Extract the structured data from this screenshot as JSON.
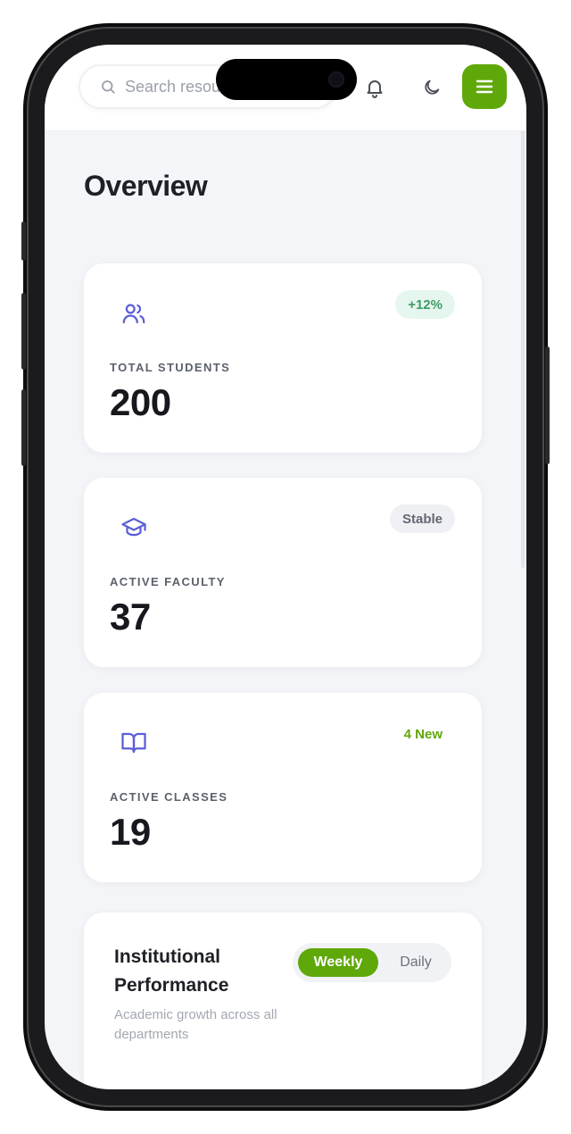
{
  "header": {
    "search_placeholder": "Search resources...",
    "icons": [
      "search-icon",
      "bell-icon",
      "moon-icon",
      "hamburger-menu-icon"
    ],
    "accent_color": "#5fa80a"
  },
  "page": {
    "title": "Overview"
  },
  "stats": [
    {
      "icon": "users-icon",
      "label": "TOTAL STUDENTS",
      "value": "200",
      "badge": "+12%",
      "badge_style": "green"
    },
    {
      "icon": "graduation-cap-icon",
      "label": "ACTIVE FACULTY",
      "value": "37",
      "badge": "Stable",
      "badge_style": "gray"
    },
    {
      "icon": "book-open-icon",
      "label": "ACTIVE CLASSES",
      "value": "19",
      "badge": "4 New",
      "badge_style": "plain"
    }
  ],
  "performance": {
    "title": "Institutional Performance",
    "subtitle": "Academic growth across all departments",
    "toggle_options": [
      "Weekly",
      "Daily"
    ],
    "selected": "Weekly"
  }
}
